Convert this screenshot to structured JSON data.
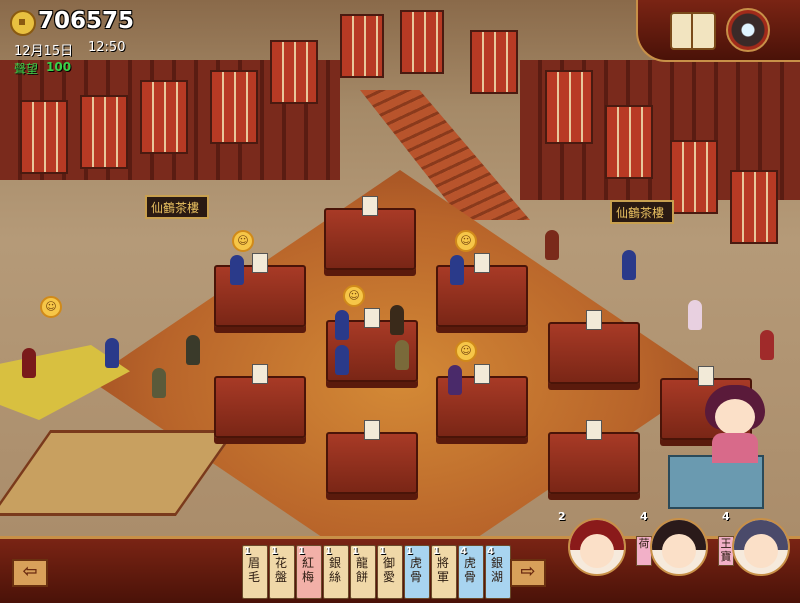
{
  "hud": {
    "money": "706575",
    "date": "12月15日",
    "time": "12:50",
    "fame_label": "聲望",
    "fame_value": "100"
  },
  "cards": [
    {
      "qty": "1",
      "name": "眉毛",
      "color": "#f0d8a8"
    },
    {
      "qty": "1",
      "name": "花盤",
      "color": "#f0d8a8"
    },
    {
      "qty": "1",
      "name": "紅梅",
      "color": "#f2b0a8"
    },
    {
      "qty": "1",
      "name": "銀絲",
      "color": "#f0d8a8"
    },
    {
      "qty": "1",
      "name": "龍餅",
      "color": "#f0d8a8"
    },
    {
      "qty": "1",
      "name": "御愛",
      "color": "#f0d8a8"
    },
    {
      "qty": "1",
      "name": "虎骨",
      "color": "#a8d4f0"
    },
    {
      "qty": "1",
      "name": "將軍",
      "color": "#f0d8a8"
    },
    {
      "qty": "4",
      "name": "虎骨",
      "color": "#a8d4f0"
    },
    {
      "qty": "4",
      "name": "銀湖",
      "color": "#a8d4f0"
    }
  ],
  "portraits": [
    {
      "count": "2",
      "tag": "",
      "hair": "#8a1a1a"
    },
    {
      "count": "4",
      "tag": "荷",
      "hair": "#2a1a1a"
    },
    {
      "count": "4",
      "tag": "王寶",
      "hair": "#4a4a6a"
    }
  ],
  "signs": [
    "仙鶴茶樓",
    "仙鶴茶樓"
  ],
  "colors": {
    "accent": "#c89048",
    "panel": "#7a2414",
    "fame": "#3ad24a"
  }
}
